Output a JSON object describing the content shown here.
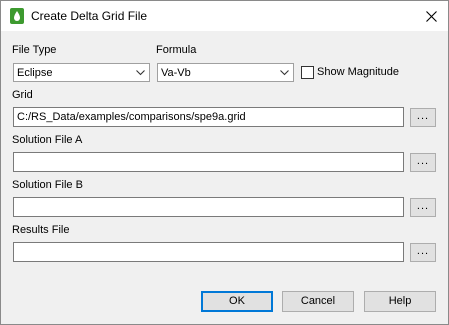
{
  "window": {
    "title": "Create Delta Grid File"
  },
  "file_type": {
    "label": "File Type",
    "selected": "Eclipse"
  },
  "formula": {
    "label": "Formula",
    "selected": "Va-Vb"
  },
  "show_magnitude": {
    "label": "Show Magnitude",
    "checked": false
  },
  "grid": {
    "label": "Grid",
    "value": "C:/RS_Data/examples/comparisons/spe9a.grid",
    "browse_label": "..."
  },
  "solution_a": {
    "label": "Solution File A",
    "value": "",
    "browse_label": "..."
  },
  "solution_b": {
    "label": "Solution File B",
    "value": "",
    "browse_label": "..."
  },
  "results": {
    "label": "Results File",
    "value": "",
    "browse_label": "..."
  },
  "buttons": {
    "ok": "OK",
    "cancel": "Cancel",
    "help": "Help"
  },
  "colors": {
    "accent": "#0078d7",
    "icon_green": "#3d9a2f"
  }
}
